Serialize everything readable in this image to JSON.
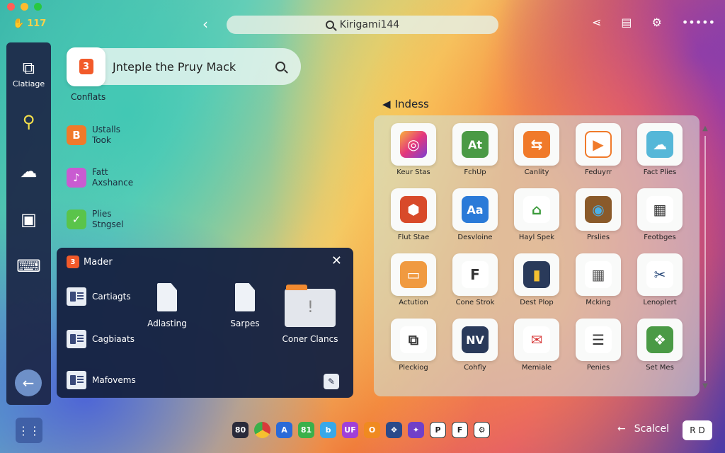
{
  "topbar": {
    "battery": "117",
    "search_value": "Kirigami144",
    "right_icons": [
      "share-icon",
      "notes-icon",
      "gear-icon",
      "more-icon"
    ]
  },
  "rail": {
    "items": [
      {
        "icon": "crop-icon",
        "label": "Clatiage"
      },
      {
        "icon": "search-icon",
        "label": ""
      },
      {
        "icon": "cloud-icon",
        "label": ""
      },
      {
        "icon": "terminal-icon",
        "label": ""
      },
      {
        "icon": "cast-icon",
        "label": ""
      }
    ],
    "back_icon": "arrow-left-icon"
  },
  "search_card": {
    "text": "Jntepl‌e the Pruy Mack",
    "sub": "Conflats"
  },
  "left_list": [
    {
      "line1": "Ustalls",
      "line2": "Took",
      "color": "#f07a2a",
      "glyph": "B"
    },
    {
      "line1": "Fatt",
      "line2": "Axshance",
      "color": "#c95bd1",
      "glyph": "♪"
    },
    {
      "line1": "Plies",
      "line2": "Stngsel",
      "color": "#5ac44a",
      "glyph": "✓"
    }
  ],
  "panel": {
    "title": "Mader",
    "rows": [
      "Cartiagts",
      "Cagbiaats",
      "Mafovems"
    ],
    "files": [
      {
        "label": "Adlasting"
      },
      {
        "label": "Sarpes"
      }
    ],
    "folder_label": "Coner Clancs"
  },
  "index": {
    "title": "Indess",
    "tiles": [
      {
        "label": "Keur Stas",
        "icon": "camera-icon"
      },
      {
        "label": "FchUp",
        "icon": "at-icon"
      },
      {
        "label": "Canlity",
        "icon": "switch-icon"
      },
      {
        "label": "Feduyrr",
        "icon": "play-icon"
      },
      {
        "label": "Fact Plies",
        "icon": "cloud-sync-icon"
      },
      {
        "label": "Flut Stae",
        "icon": "shield-icon"
      },
      {
        "label": "Desvloine",
        "icon": "font-icon"
      },
      {
        "label": "Hayl Spek",
        "icon": "house-icon"
      },
      {
        "label": "Prslies",
        "icon": "globe-icon"
      },
      {
        "label": "Feotbges",
        "icon": "dashboard-icon"
      },
      {
        "label": "Actution",
        "icon": "folder-icon"
      },
      {
        "label": "Cone Strok",
        "icon": "type-icon"
      },
      {
        "label": "Dest Plop",
        "icon": "chart-icon"
      },
      {
        "label": "Mcking",
        "icon": "grid-icon"
      },
      {
        "label": "Lenoplert",
        "icon": "tools-icon"
      },
      {
        "label": "Pleckiog",
        "icon": "book-icon"
      },
      {
        "label": "Cohfly",
        "icon": "nv-icon"
      },
      {
        "label": "Memiale",
        "icon": "mail-icon"
      },
      {
        "label": "Penies",
        "icon": "doc-icon"
      },
      {
        "label": "Set Mes",
        "icon": "leaf-icon"
      }
    ],
    "tile_glyphs": {
      "Kat": "At",
      "Aa": "Aa",
      "NV": "NV",
      "F": "F"
    }
  },
  "bottombar": {
    "dock": [
      "80",
      "",
      "A",
      "81",
      "b",
      "UF",
      "O",
      "❖",
      "✦",
      "P",
      "F",
      "⚙"
    ],
    "scroll_label": "Scalcel",
    "rd_label": "R D"
  }
}
